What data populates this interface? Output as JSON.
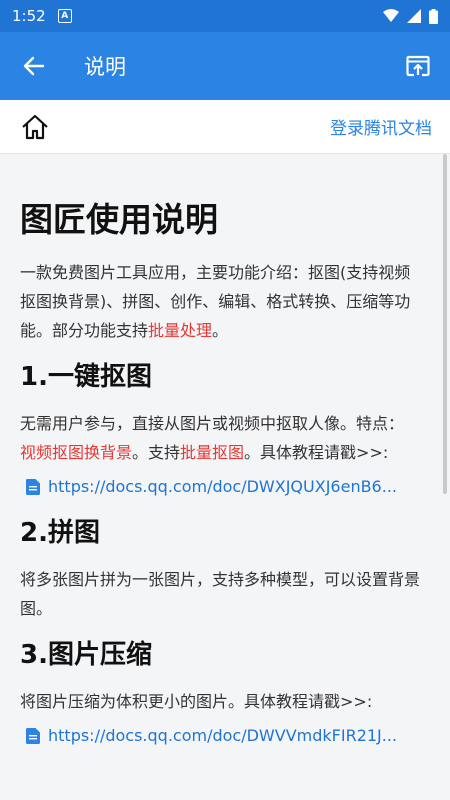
{
  "status_bar": {
    "time": "1:52",
    "badge": "A"
  },
  "app_bar": {
    "title": "说明"
  },
  "doc_header": {
    "login_label": "登录腾讯文档"
  },
  "doc": {
    "title": "图匠使用说明",
    "intro": {
      "text": "一款免费图片工具应用，主要功能介绍：抠图(支持视频抠图换背景)、拼图、创作、编辑、格式转换、压缩等功能。部分功能支持",
      "highlight": "批量处理",
      "end": "。"
    },
    "s1": {
      "heading": "1.一键抠图",
      "t1": "无需用户参与，直接从图片或视频中抠取人像。特点：",
      "h1": "视频抠图换背景",
      "t2": "。支持",
      "h2": "批量抠图",
      "t3": "。具体教程请戳>>:",
      "link": "https://docs.qq.com/doc/DWXJQUXJ6enB6..."
    },
    "s2": {
      "heading": "2.拼图",
      "text": "将多张图片拼为一张图片，支持多种模型，可以设置背景图。"
    },
    "s3": {
      "heading": "3.图片压缩",
      "text": "将图片压缩为体积更小的图片。具体教程请戳>>:",
      "link": "https://docs.qq.com/doc/DWVVmdkFIR21J..."
    }
  }
}
